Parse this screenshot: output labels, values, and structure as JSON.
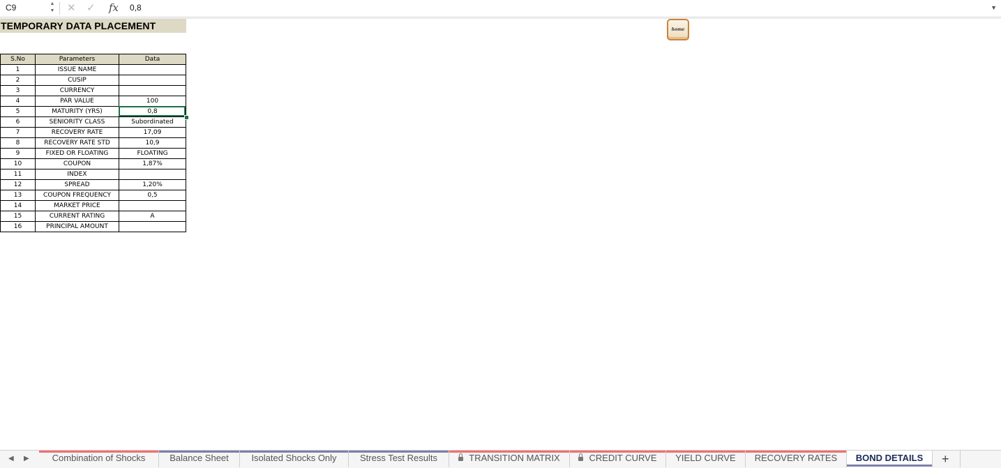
{
  "formula_bar": {
    "cell_ref": "C9",
    "cancel_symbol": "✕",
    "confirm_symbol": "✓",
    "fx_symbol": "fx",
    "value": "0,8"
  },
  "sheet": {
    "title": "TEMPORARY DATA PLACEMENT",
    "home_button_label": "home",
    "columns": [
      "S.No",
      "Parameters",
      "Data"
    ],
    "rows": [
      {
        "no": "1",
        "param": "ISSUE NAME",
        "data": ""
      },
      {
        "no": "2",
        "param": "CUSIP",
        "data": ""
      },
      {
        "no": "3",
        "param": "CURRENCY",
        "data": ""
      },
      {
        "no": "4",
        "param": "PAR VALUE",
        "data": "100"
      },
      {
        "no": "5",
        "param": "MATURITY (YRS)",
        "data": "0,8"
      },
      {
        "no": "6",
        "param": "SENIORITY CLASS",
        "data": "Subordinated"
      },
      {
        "no": "7",
        "param": "RECOVERY RATE",
        "data": "17,09"
      },
      {
        "no": "8",
        "param": "RECOVERY RATE STD",
        "data": "10,9"
      },
      {
        "no": "9",
        "param": "FIXED OR FLOATING",
        "data": "FLOATING"
      },
      {
        "no": "10",
        "param": "COUPON",
        "data": "1,87%"
      },
      {
        "no": "11",
        "param": "INDEX",
        "data": ""
      },
      {
        "no": "12",
        "param": "SPREAD",
        "data": "1,20%"
      },
      {
        "no": "13",
        "param": "COUPON FREQUENCY",
        "data": "0,5"
      },
      {
        "no": "14",
        "param": "MARKET PRICE",
        "data": ""
      },
      {
        "no": "15",
        "param": "CURRENT RATING",
        "data": "A"
      },
      {
        "no": "16",
        "param": "PRINCIPAL AMOUNT",
        "data": ""
      }
    ]
  },
  "tabs": [
    {
      "label": "Combination of Shocks",
      "locked": false,
      "active": false,
      "color": "#f07070"
    },
    {
      "label": "Balance Sheet",
      "locked": false,
      "active": false,
      "color": "#7f7fa8"
    },
    {
      "label": "Isolated Shocks Only",
      "locked": false,
      "active": false,
      "color": "#7f7fa8"
    },
    {
      "label": "Stress Test Results",
      "locked": false,
      "active": false,
      "color": "#7f7fa8"
    },
    {
      "label": "TRANSITION MATRIX",
      "locked": true,
      "active": false,
      "color": "#f07070"
    },
    {
      "label": "CREDIT CURVE",
      "locked": true,
      "active": false,
      "color": "#f07070"
    },
    {
      "label": "YIELD CURVE",
      "locked": false,
      "active": false,
      "color": "#f07070"
    },
    {
      "label": "RECOVERY RATES",
      "locked": false,
      "active": false,
      "color": "#f07070"
    },
    {
      "label": "BOND DETAILS",
      "locked": false,
      "active": true,
      "color": "#7f7fa8"
    }
  ],
  "tab_nav": {
    "prev": "◀",
    "next": "▶",
    "add": "+"
  }
}
